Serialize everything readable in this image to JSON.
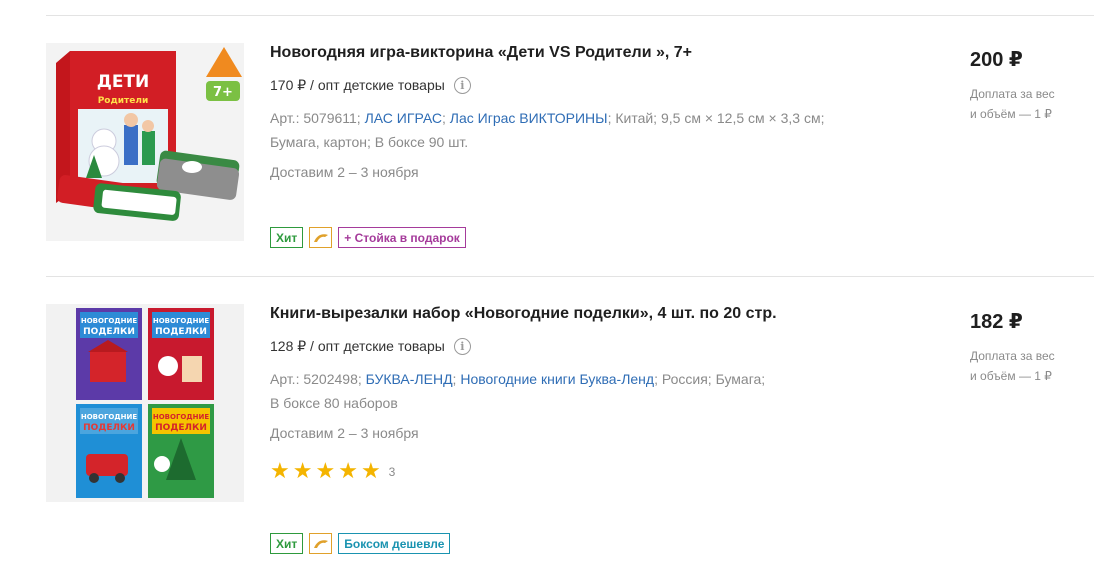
{
  "products": [
    {
      "title": "Новогодняя игра-викторина «Дети VS Родители », 7+",
      "wholesale": "170 ₽ / опт детские товары",
      "art": "Арт.: 5079611;",
      "brand": "ЛАС ИГРАС",
      "collection": "Лас Играс ВИКТОРИНЫ",
      "country": "Китай;",
      "size": "9,5 см × 12,5 см × 3,3 см;",
      "material": "Бумага, картон;",
      "box": "В боксе 90 шт.",
      "delivery": "Доставим 2 – 3 ноября",
      "price": "200 ₽",
      "surcharge_line1": "Доплата за вес",
      "surcharge_line2": "и объём — 1 ₽",
      "badges": {
        "hit": "Хит",
        "promo": "+ Стойка в подарок"
      },
      "image": {
        "title_word": "ДЕТИ",
        "subtitle_word": "Родители",
        "age": "7+"
      }
    },
    {
      "title": "Книги-вырезалки набор «Новогодние поделки», 4 шт. по 20 стр.",
      "wholesale": "128 ₽ / опт детские товары",
      "art": "Арт.: 5202498;",
      "brand": "БУКВА-ЛЕНД",
      "collection": "Новогодние книги Буква-Ленд",
      "country": "Россия;",
      "material": "Бумага;",
      "box": "В боксе 80 наборов",
      "delivery": "Доставим 2 – 3 ноября",
      "rating": 5,
      "rating_count": "3",
      "price": "182 ₽",
      "surcharge_line1": "Доплата за вес",
      "surcharge_line2": "и объём — 1 ₽",
      "badges": {
        "hit": "Хит",
        "promo": "Боксом дешевле"
      },
      "image": {
        "book_line1": "НОВОГОДНИЕ",
        "book_line2": "ПОДЕЛКИ"
      }
    }
  ],
  "colors": {
    "link": "#2f6db5",
    "hit": "#2e9a3d",
    "gift": "#a53b9b",
    "box": "#1a93b0",
    "star": "#f4b400"
  }
}
